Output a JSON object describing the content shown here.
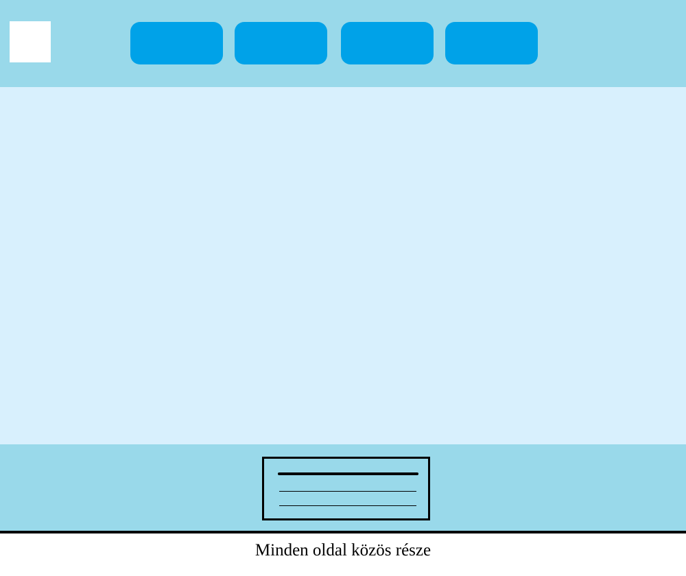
{
  "caption": "Minden oldal közös része",
  "colors": {
    "header_bg": "#99d9ea",
    "content_bg": "#d8f0fd",
    "nav_button": "#00a2e8",
    "logo_placeholder": "#ffffff",
    "outline": "#000000"
  },
  "header": {
    "logo": {
      "icon": "logo-placeholder-icon"
    },
    "nav_buttons": [
      {
        "label": ""
      },
      {
        "label": ""
      },
      {
        "label": ""
      },
      {
        "label": ""
      }
    ]
  },
  "footer": {
    "box": {
      "icon": "text-lines-icon"
    }
  }
}
